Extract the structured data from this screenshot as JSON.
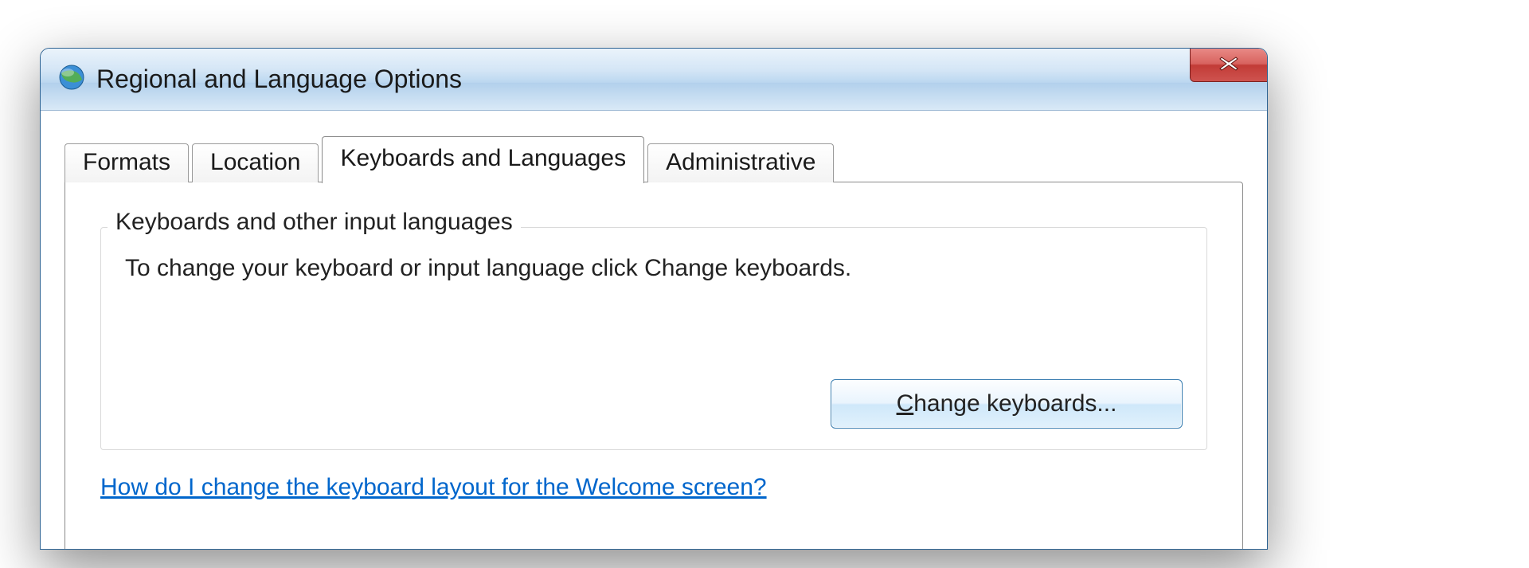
{
  "window": {
    "title": "Regional and Language Options"
  },
  "tabs": {
    "formats": "Formats",
    "location": "Location",
    "keyboards": "Keyboards and Languages",
    "administrative": "Administrative"
  },
  "group": {
    "legend": "Keyboards and other input languages",
    "body": "To change your keyboard or input language click Change keyboards.",
    "button_pre": "",
    "button_mn": "C",
    "button_post": "hange keyboards..."
  },
  "help_link": "How do I change the keyboard layout for the Welcome screen?",
  "colors": {
    "link": "#0066cc",
    "accent": "#3c7fb1",
    "close1": "#d8625e",
    "close2": "#c23b36"
  }
}
